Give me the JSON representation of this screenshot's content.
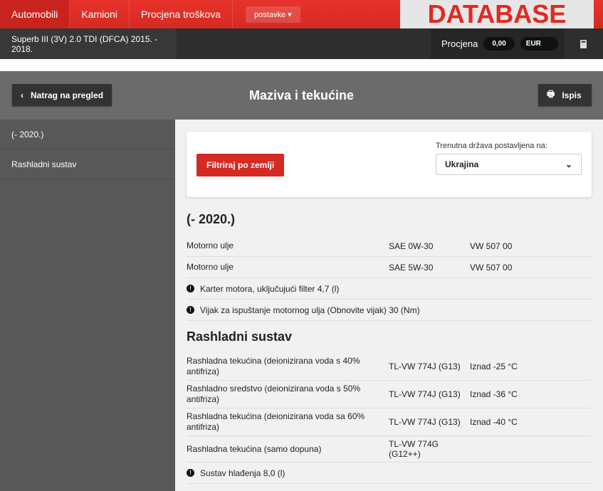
{
  "nav": {
    "items": [
      "Automobili",
      "Kamioni",
      "Procjena troškova"
    ],
    "settings": "postavke",
    "logo": "DATABASE"
  },
  "vehicle": "Superb III (3V) 2.0 TDI (DFCA) 2015. - 2018.",
  "estimate": {
    "label": "Procjena",
    "value": "0,00",
    "currency": "EUR"
  },
  "header": {
    "back": "Natrag na pregled",
    "title": "Maziva i tekućine",
    "print": "Ispis"
  },
  "sidebar": [
    "(- 2020.)",
    "Rashladni sustav"
  ],
  "filter": {
    "button": "Filtriraj po zemlji",
    "label": "Trenutna država postavljena na:",
    "selected": "Ukrajina"
  },
  "sections": [
    {
      "title": "(- 2020.)",
      "rows": [
        [
          "Motorno ulje",
          "SAE 0W-30",
          "VW 507 00"
        ],
        [
          "Motorno ulje",
          "SAE 5W-30",
          "VW 507 00"
        ]
      ],
      "notes": [
        "Karter motora, uključujući filter 4,7 (l)",
        "Vijak za ispuštanje motornog ulja (Obnovite vijak) 30 (Nm)"
      ]
    },
    {
      "title": "Rashladni sustav",
      "rows": [
        [
          "Rashladna tekućina (deionizirana voda s 40% antifriza)",
          "TL-VW 774J (G13)",
          "Iznad -25 °C"
        ],
        [
          "Rashladno sredstvo (deionizirana voda s 50% antifriza)",
          "TL-VW 774J (G13)",
          "Iznad -36 °C"
        ],
        [
          "Rashladna tekućina (deionizirana voda sa 60% antifriza)",
          "TL-VW 774J (G13)",
          "Iznad -40 °C"
        ],
        [
          "Rashladna tekućina (samo dopuna)",
          "TL-VW 774G (G12++)",
          ""
        ]
      ],
      "notes": [
        "Sustav hlađenja 8,0 (l)"
      ]
    }
  ]
}
